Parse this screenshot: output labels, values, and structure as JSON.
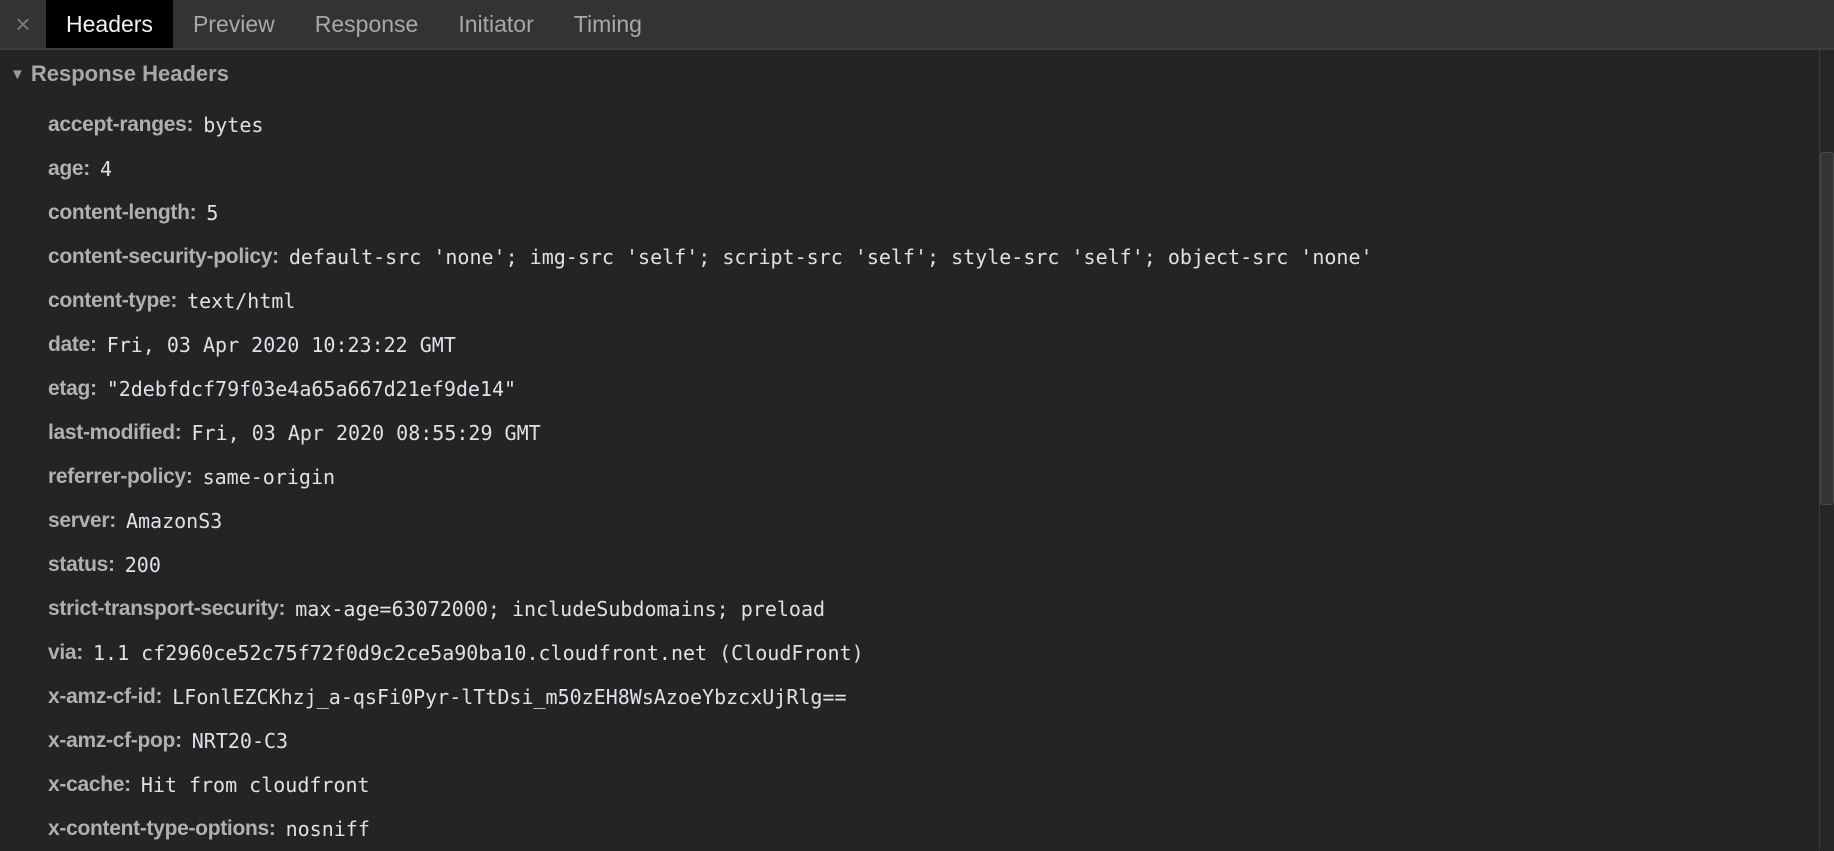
{
  "tabs": {
    "close_icon": "×",
    "items": [
      {
        "label": "Headers",
        "active": true
      },
      {
        "label": "Preview"
      },
      {
        "label": "Response"
      },
      {
        "label": "Initiator"
      },
      {
        "label": "Timing"
      }
    ]
  },
  "section": {
    "title": "Response Headers",
    "expanded": true
  },
  "headers": [
    {
      "name": "accept-ranges:",
      "value": "bytes"
    },
    {
      "name": "age:",
      "value": "4"
    },
    {
      "name": "content-length:",
      "value": "5"
    },
    {
      "name": "content-security-policy:",
      "value": "default-src 'none'; img-src 'self'; script-src 'self'; style-src 'self'; object-src 'none'"
    },
    {
      "name": "content-type:",
      "value": "text/html"
    },
    {
      "name": "date:",
      "value": "Fri, 03 Apr 2020 10:23:22 GMT"
    },
    {
      "name": "etag:",
      "value": "\"2debfdcf79f03e4a65a667d21ef9de14\""
    },
    {
      "name": "last-modified:",
      "value": "Fri, 03 Apr 2020 08:55:29 GMT"
    },
    {
      "name": "referrer-policy:",
      "value": "same-origin"
    },
    {
      "name": "server:",
      "value": "AmazonS3"
    },
    {
      "name": "status:",
      "value": "200"
    },
    {
      "name": "strict-transport-security:",
      "value": "max-age=63072000; includeSubdomains; preload"
    },
    {
      "name": "via:",
      "value": "1.1 cf2960ce52c75f72f0d9c2ce5a90ba10.cloudfront.net (CloudFront)"
    },
    {
      "name": "x-amz-cf-id:",
      "value": "LFonlEZCKhzj_a-qsFi0Pyr-lTtDsi_m50zEH8WsAzoeYbzcxUjRlg=="
    },
    {
      "name": "x-amz-cf-pop:",
      "value": "NRT20-C3"
    },
    {
      "name": "x-cache:",
      "value": "Hit from cloudfront"
    },
    {
      "name": "x-content-type-options:",
      "value": "nosniff"
    }
  ]
}
